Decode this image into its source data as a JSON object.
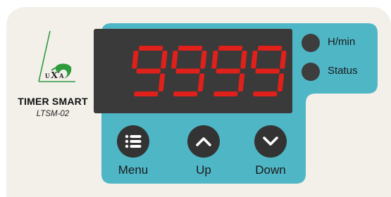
{
  "brand": {
    "logo_text": "UXA",
    "title": "TIMER SMART",
    "model": "LTSM-02"
  },
  "display": {
    "left_digits": "99",
    "right_digits": "99",
    "digit_color": "#e0201a"
  },
  "indicators": [
    {
      "label": "H/min",
      "icon": "indicator-led"
    },
    {
      "label": "Status",
      "icon": "indicator-led"
    }
  ],
  "buttons": [
    {
      "label": "Menu",
      "icon": "list-icon"
    },
    {
      "label": "Up",
      "icon": "chevron-up-icon"
    },
    {
      "label": "Down",
      "icon": "chevron-down-icon"
    }
  ],
  "colors": {
    "panel": "#4fb6c6",
    "body": "#f3f0ea",
    "logo_green": "#2e9a3e"
  }
}
